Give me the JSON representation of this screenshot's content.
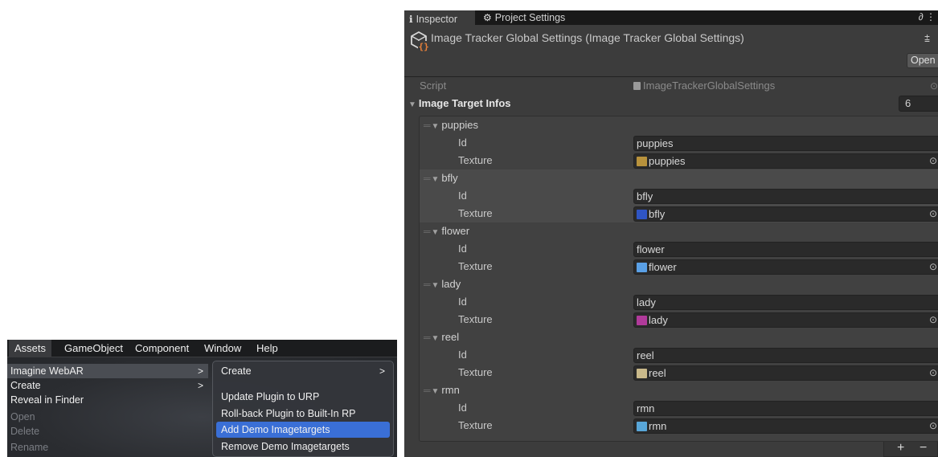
{
  "menu_screenshot": {
    "menubar": [
      "Assets",
      "GameObject",
      "Component",
      "Window",
      "Help"
    ],
    "assets_menu": [
      {
        "label": "Imagine WebAR",
        "submenu": true,
        "state": "highlighted"
      },
      {
        "label": "Create",
        "submenu": true,
        "state": "normal"
      },
      {
        "label": "Reveal in Finder",
        "submenu": false,
        "state": "normal"
      },
      {
        "label": "Open",
        "submenu": false,
        "state": "disabled"
      },
      {
        "label": "Delete",
        "submenu": false,
        "state": "disabled"
      },
      {
        "label": "Rename",
        "submenu": false,
        "state": "disabled"
      }
    ],
    "submenu": [
      {
        "label": "Create",
        "submenu": true,
        "state": "normal"
      },
      {
        "label": "Update Plugin to URP",
        "submenu": false,
        "state": "normal"
      },
      {
        "label": "Roll-back Plugin to Built-In RP",
        "submenu": false,
        "state": "normal"
      },
      {
        "label": "Add Demo Imagetargets",
        "submenu": false,
        "state": "highlighted"
      },
      {
        "label": "Remove Demo Imagetargets",
        "submenu": false,
        "state": "normal"
      }
    ],
    "arrow": ">"
  },
  "inspector": {
    "tabs": [
      {
        "icon": "info-icon",
        "glyph": "ℹ",
        "label": "Inspector"
      },
      {
        "icon": "gear-icon",
        "glyph": "⚙",
        "label": "Project Settings"
      }
    ],
    "tab_menu_glyph": "∂ ⋮",
    "title": "Image Tracker Global Settings (Image Tracker Global Settings)",
    "tune_glyph": "⩲",
    "open_button": "Open",
    "script": {
      "label": "Script",
      "value": "ImageTrackerGlobalSettings",
      "dot": "⊙"
    },
    "list": {
      "label": "Image Target Infos",
      "count": "6"
    },
    "field_labels": {
      "id": "Id",
      "texture": "Texture"
    },
    "entries": [
      {
        "name": "puppies",
        "id": "puppies",
        "texture": "puppies",
        "thumb": "#b8923c",
        "selected": false
      },
      {
        "name": "bfly",
        "id": "bfly",
        "texture": "bfly",
        "thumb": "#2f55c4",
        "selected": true
      },
      {
        "name": "flower",
        "id": "flower",
        "texture": "flower",
        "thumb": "#5aa0e6",
        "selected": false
      },
      {
        "name": "lady",
        "id": "lady",
        "texture": "lady",
        "thumb": "#b03a9a",
        "selected": false
      },
      {
        "name": "reel",
        "id": "reel",
        "texture": "reel",
        "thumb": "#c9b98a",
        "selected": false
      },
      {
        "name": "rmn",
        "id": "rmn",
        "texture": "rmn",
        "thumb": "#58a6d8",
        "selected": false
      }
    ],
    "footer": {
      "add": "+",
      "remove": "−"
    }
  }
}
